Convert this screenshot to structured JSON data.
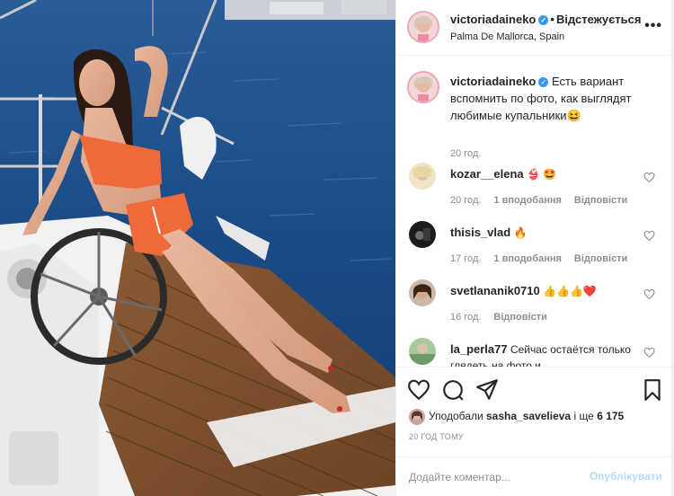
{
  "post": {
    "username": "victoriadaineko",
    "verified_mark": "✓",
    "dot": "•",
    "follow_label": "Відстежується",
    "location": "Palma De Mallorca, Spain",
    "more_icon": "more-horizontal-icon",
    "more_glyph": "•••"
  },
  "caption": {
    "username": "victoriadaineko",
    "text": "Есть вариант вспомнить по фото, как выглядят любимые купальники😆",
    "time": "20 год."
  },
  "comments": [
    {
      "username": "kozar__elena",
      "text": "👙 🤩",
      "time": "20 год.",
      "likes": "1 вподобання",
      "reply": "Відповісти"
    },
    {
      "username": "thisis_vlad",
      "text": "🔥",
      "time": "17 год.",
      "likes": "1 вподобання",
      "reply": "Відповісти"
    },
    {
      "username": "svetlananik0710",
      "text": "👍👍👍❤️",
      "time": "16 год.",
      "likes": "",
      "reply": "Відповісти"
    },
    {
      "username": "la_perla77",
      "text": "Сейчас остаётся только глядеть на фото и",
      "time": "",
      "likes": "",
      "reply": ""
    }
  ],
  "actions": {
    "like_icon": "heart-icon",
    "comment_icon": "comment-icon",
    "share_icon": "send-icon",
    "save_icon": "bookmark-icon"
  },
  "likes_line": {
    "prefix": "Уподобали",
    "user": "sasha_savelieva",
    "middle": "і ще",
    "count": "6 175"
  },
  "post_time": "20 ГОД ТОМУ",
  "add_comment": {
    "placeholder": "Додайте коментар...",
    "publish_label": "Опублікувати"
  },
  "colors": {
    "link_blue": "#3897f0",
    "publish_disabled": "#b3dbff",
    "muted": "#8e8e8e",
    "text": "#262626",
    "sea": "#1a4f8e",
    "swimsuit": "#f0693a"
  }
}
